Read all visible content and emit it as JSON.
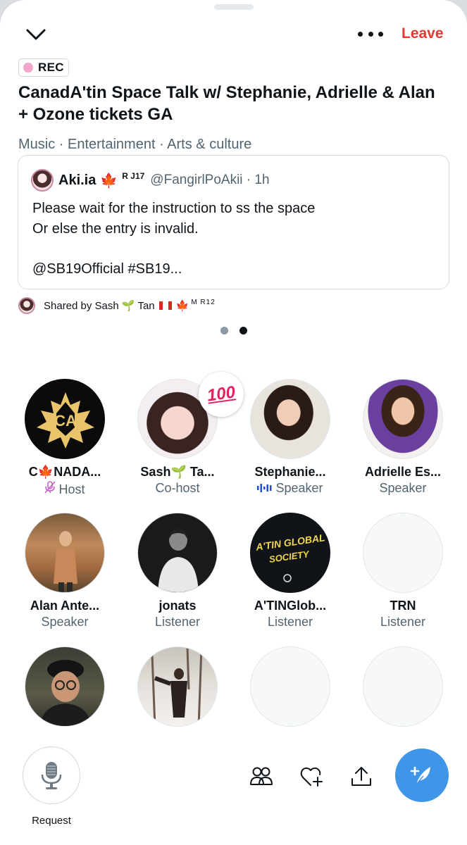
{
  "header": {
    "more_label": "•••",
    "leave_label": "Leave"
  },
  "space": {
    "rec_label": "REC",
    "title": "CanadA'tin Space Talk w/ Stephanie, Adrielle & Alan + Ozone tickets GA",
    "topics": "Music · Entertainment · Arts & culture"
  },
  "tweet": {
    "name": "Aki.ia",
    "name_emoji": "🍁",
    "name_sup": "R J17",
    "handle": "@FangirlPoAkii · 1h",
    "lines": [
      "Please wait for the instruction to ss the space",
      "Or else the entry is invalid.",
      "",
      "@SB19Official #SB19..."
    ]
  },
  "shared": {
    "prefix": "Shared by Sash",
    "sprout": "🌱",
    "suffix": "Tan",
    "leaf": "🍁",
    "sup": "M R12"
  },
  "participants": [
    {
      "name_a": "C",
      "name_leaf": "🍁",
      "name_b": "NADA...",
      "role": "Host",
      "role_icon": "muted-mic-icon"
    },
    {
      "name_a": "Sash",
      "name_leaf": "🌱",
      "name_b": " Ta...",
      "role": "Co-host",
      "reaction": "100"
    },
    {
      "name_a": "Stephanie...",
      "role": "Speaker",
      "role_icon": "speaking-wave-icon"
    },
    {
      "name_a": "Adrielle Es...",
      "role": "Speaker"
    },
    {
      "name_a": "Alan Ante...",
      "role": "Speaker"
    },
    {
      "name_a": "jonats",
      "role": "Listener"
    },
    {
      "name_a": "A'TINGlob...",
      "role": "Listener",
      "avatar_text": "A'TIN GLOBAL SOCIETY"
    },
    {
      "name_a": "TRN",
      "role": "Listener"
    }
  ],
  "bottom": {
    "request_label": "Request"
  },
  "colors": {
    "leave": "#df3a34",
    "fab": "#3f96e8",
    "rec_dot": "#f4a7cb",
    "muted_text": "#536471"
  }
}
